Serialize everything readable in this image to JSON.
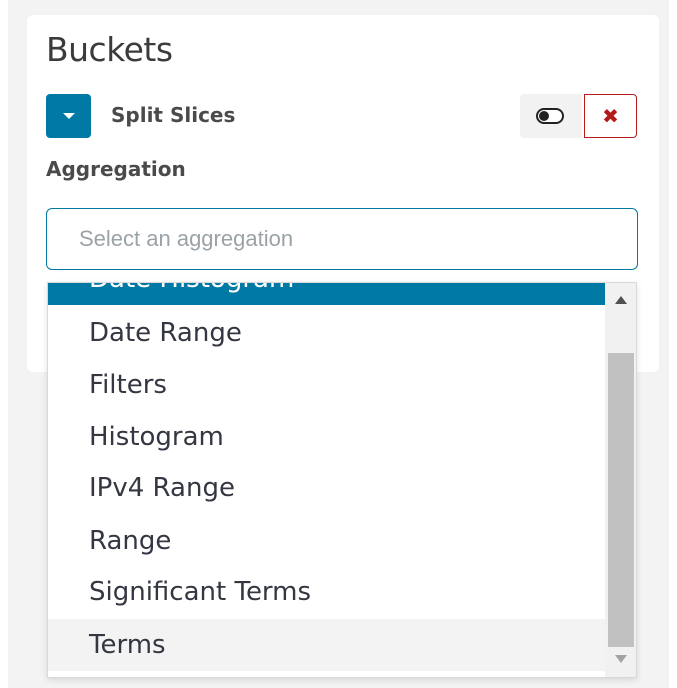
{
  "panel": {
    "title": "Buckets"
  },
  "bucket": {
    "label": "Split Slices",
    "toggle_icon": "caret-down-icon",
    "enable_icon": "toggle-switch-icon",
    "remove_icon": "close-icon",
    "remove_symbol": "✖"
  },
  "aggregation": {
    "label": "Aggregation",
    "placeholder": "Select an aggregation",
    "value": ""
  },
  "dropdown": {
    "options": [
      {
        "label": "Date Histogram",
        "state": "selected"
      },
      {
        "label": "Date Range",
        "state": "normal"
      },
      {
        "label": "Filters",
        "state": "normal"
      },
      {
        "label": "Histogram",
        "state": "normal"
      },
      {
        "label": "IPv4 Range",
        "state": "normal"
      },
      {
        "label": "Range",
        "state": "normal"
      },
      {
        "label": "Significant Terms",
        "state": "normal"
      },
      {
        "label": "Terms",
        "state": "hovered"
      }
    ]
  },
  "colors": {
    "accent": "#0079a5",
    "danger": "#b31b1b",
    "text": "#343741",
    "hover": "#f3f3f3"
  }
}
